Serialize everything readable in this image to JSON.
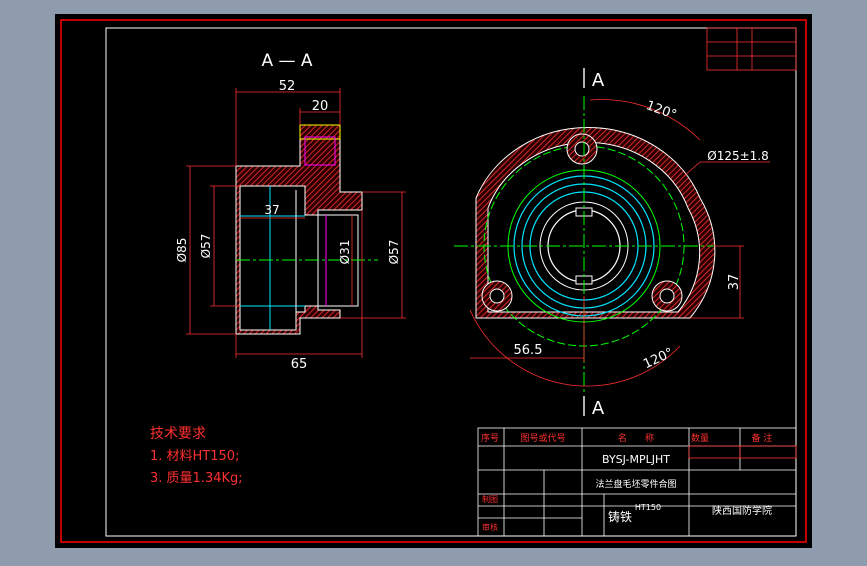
{
  "colors": {
    "background": "#8f9cae",
    "sheet": "#000000",
    "border": "#ff0000",
    "white": "#ffffff",
    "cyan": "#00e5ff",
    "green": "#00ff00",
    "yellow": "#ffff00",
    "magenta": "#ff00ff",
    "hatch": "#ff3030"
  },
  "section_view": {
    "title": "A — A",
    "dims": {
      "d52": "52",
      "d20": "20",
      "d37": "37",
      "d65": "65",
      "phi85": "Ø85",
      "phi57_left": "Ø57",
      "phi31": "Ø31",
      "phi57_right": "Ø57"
    }
  },
  "front_view": {
    "cut_top": "A",
    "cut_bottom": "A",
    "dims": {
      "angle_top": "120°",
      "angle_bottom": "120°",
      "phi125": "Ø125±1.8",
      "d56_5": "56.5",
      "d37": "37"
    }
  },
  "tech_requirements": {
    "title": "技术要求",
    "line1": "1. 材料HT150;",
    "line2": "3. 质量1.34Kg;"
  },
  "title_block": {
    "header_no": "序号",
    "header_code": "图号或代号",
    "header_name": "名　　称",
    "header_qty": "数量",
    "header_note": "备 注",
    "drawing_code": "BYSJ-MPLJHT",
    "part_name": "法兰盘毛坯零件合图",
    "material": "铸铁",
    "material_code": "HT150",
    "school": "陕西国防学院",
    "label_make": "制图",
    "label_check": "审核"
  }
}
